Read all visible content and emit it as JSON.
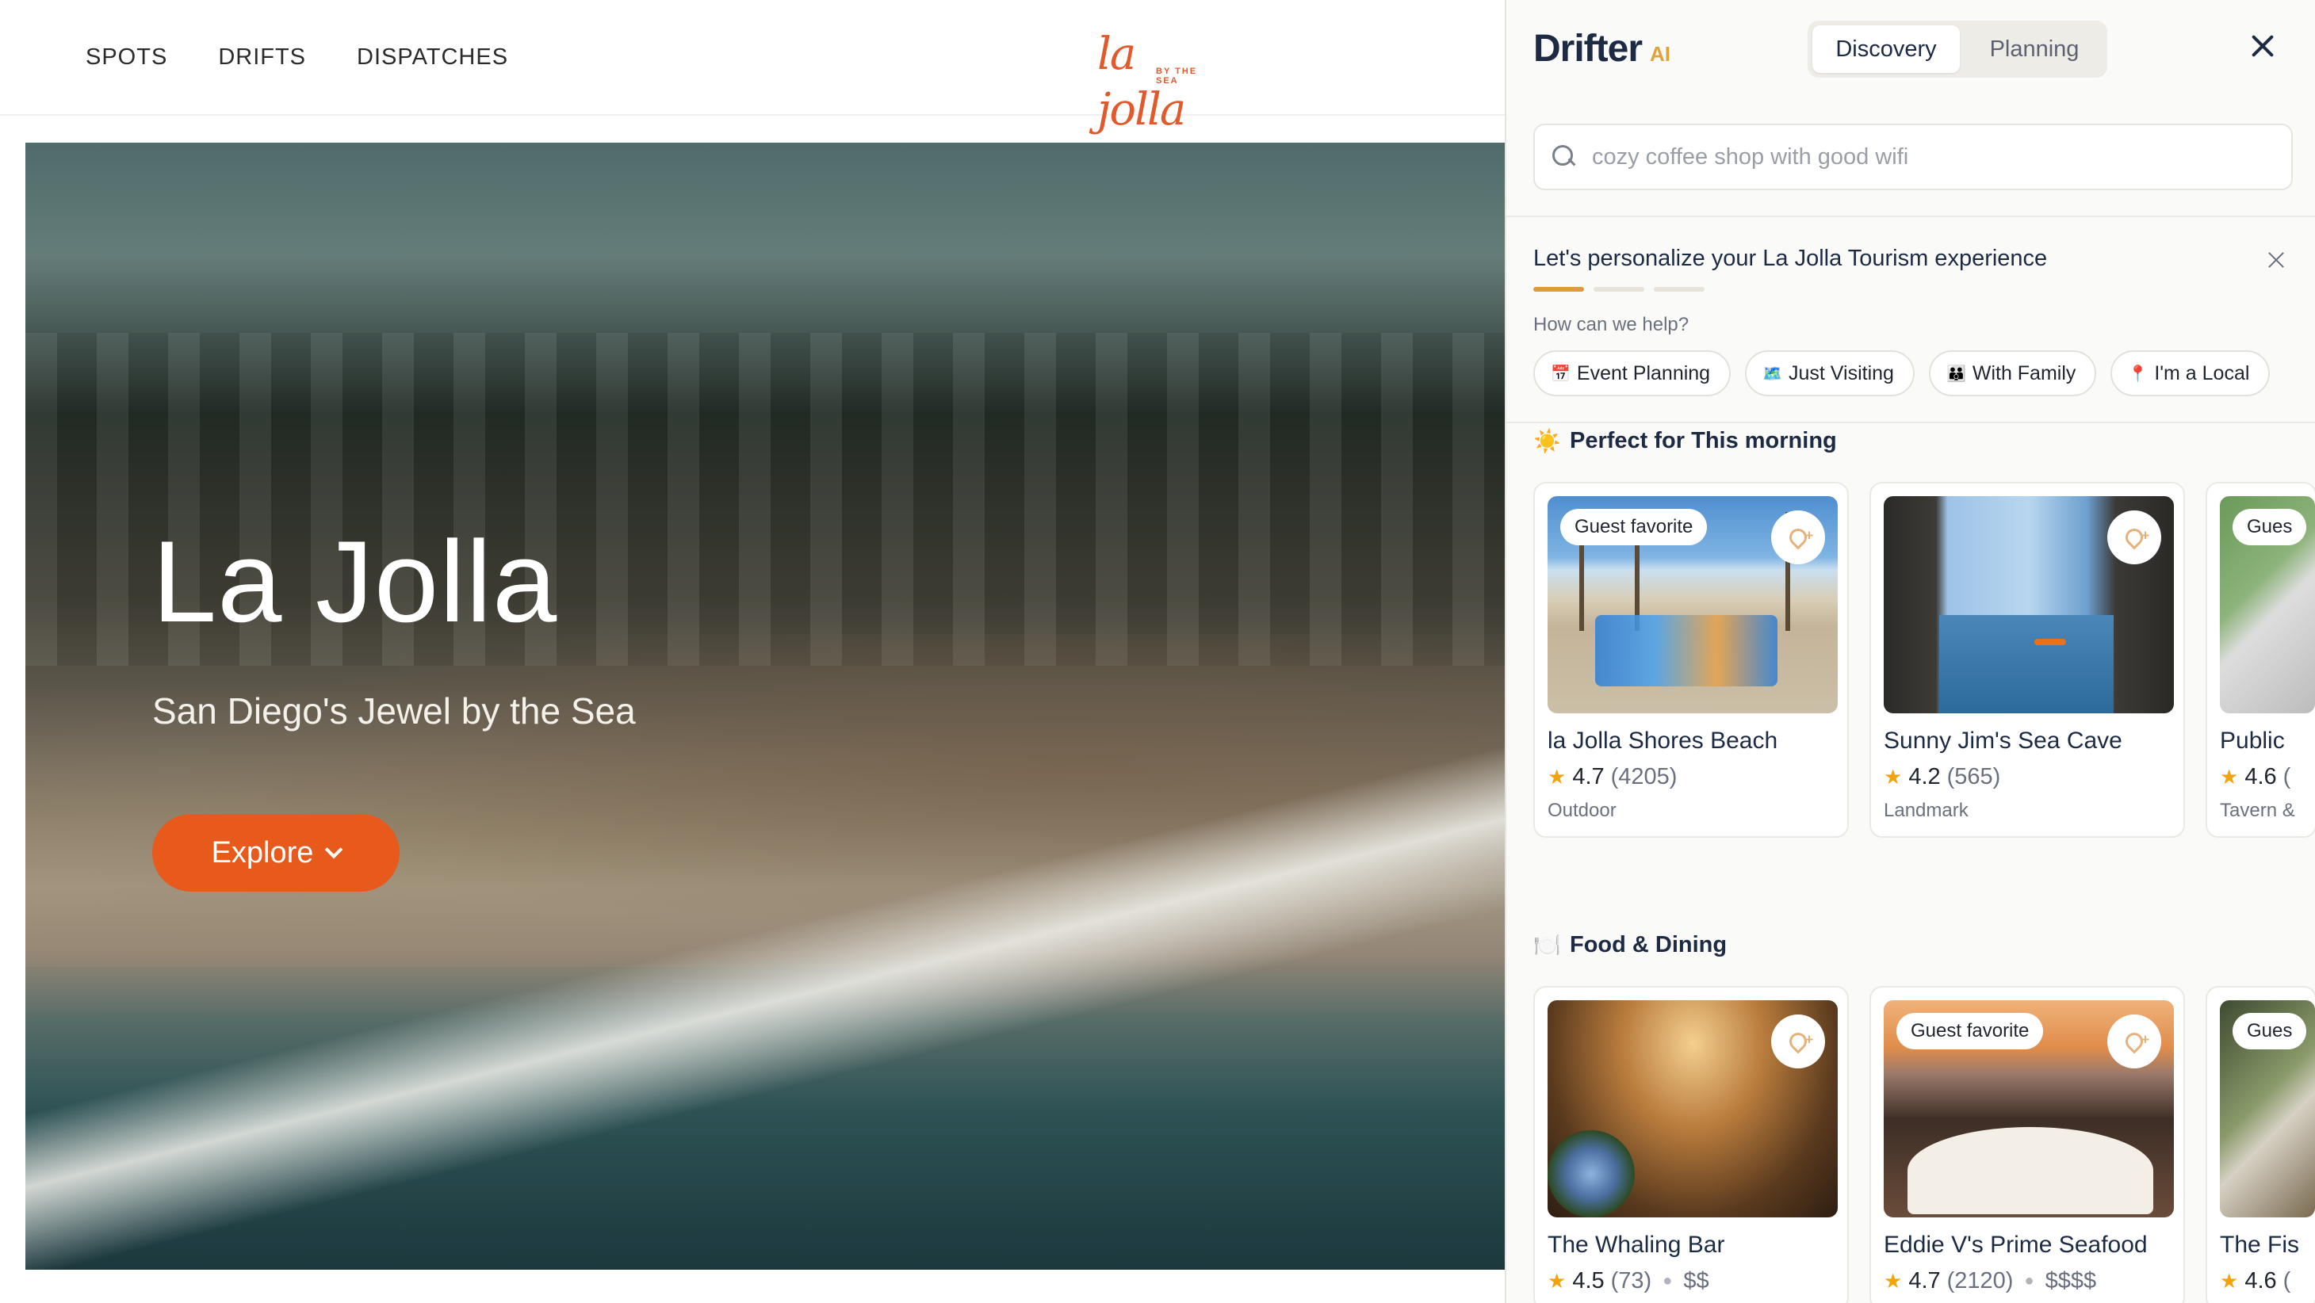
{
  "site": {
    "nav": [
      "SPOTS",
      "DRIFTS",
      "DISPATCHES"
    ],
    "logo_text": "la jolla",
    "logo_tagline": "BY THE SEA",
    "hero_title": "La Jolla",
    "hero_subtitle": "San Diego's Jewel by the Sea",
    "explore_label": "Explore"
  },
  "panel": {
    "brand": "Drifter",
    "brand_suffix": "AI",
    "tabs": {
      "discovery": "Discovery",
      "planning": "Planning"
    },
    "search_placeholder": "cozy coffee shop with good wifi",
    "personalize": {
      "title": "Let's personalize your La Jolla Tourism experience",
      "progress": {
        "step": 1,
        "total": 3
      },
      "question": "How can we help?",
      "options": [
        {
          "icon": "📅",
          "label": "Event Planning"
        },
        {
          "icon": "🗺️",
          "label": "Just Visiting"
        },
        {
          "icon": "👪",
          "label": "With Family"
        },
        {
          "icon": "📍",
          "label": "I'm a Local"
        }
      ]
    },
    "sections": [
      {
        "icon": "☀️",
        "title": "Perfect for This morning",
        "cards": [
          {
            "badge": "Guest favorite",
            "name": "la Jolla Shores Beach",
            "rating": "4.7",
            "count": "(4205)",
            "category": "Outdoor"
          },
          {
            "badge": "",
            "name": "Sunny Jim's Sea Cave",
            "rating": "4.2",
            "count": "(565)",
            "category": "Landmark"
          },
          {
            "badge": "Gues",
            "name": "Public",
            "rating": "4.6",
            "count": "(",
            "category": "Tavern &"
          }
        ]
      },
      {
        "icon": "🍽️",
        "title": "Food & Dining",
        "cards": [
          {
            "badge": "",
            "name": "The Whaling Bar",
            "rating": "4.5",
            "count": "(73)",
            "price": "$$"
          },
          {
            "badge": "Guest favorite",
            "name": "Eddie V's Prime Seafood",
            "rating": "4.7",
            "count": "(2120)",
            "price": "$$$$"
          },
          {
            "badge": "Gues",
            "name": "The Fis",
            "rating": "4.6",
            "count": "("
          }
        ]
      }
    ],
    "colors": {
      "accent": "#e8591c",
      "brand_navy": "#1d2a44",
      "ai_gold": "#e1a13b",
      "star": "#f2a40f"
    }
  }
}
